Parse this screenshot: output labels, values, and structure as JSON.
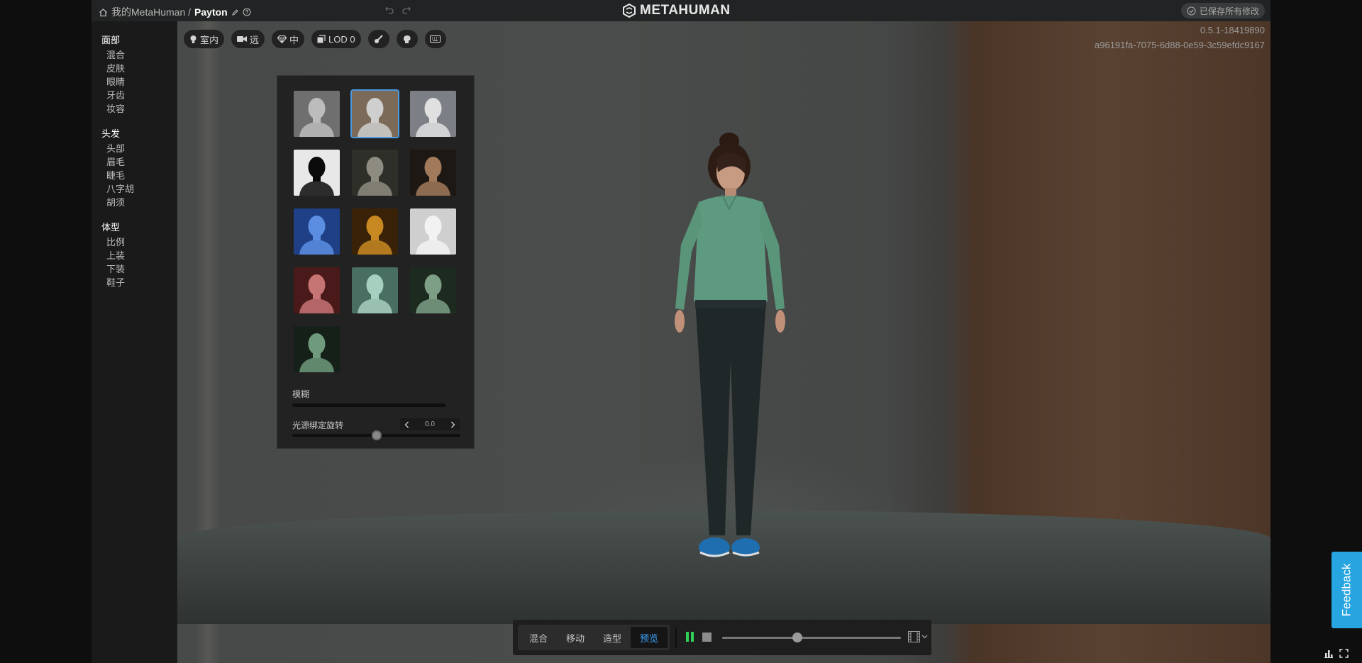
{
  "topbar": {
    "breadcrumb_root": "我的MetaHuman /",
    "breadcrumb_current": "Payton",
    "logo_text": "METAHUMAN",
    "saved_status": "已保存所有修改"
  },
  "version": {
    "build": "0.5.1-18419890",
    "id": "a96191fa-7075-6d88-0e59-3c59efdc9167"
  },
  "sidebar": {
    "sections": [
      {
        "title": "面部",
        "items": [
          "混合",
          "皮肤",
          "眼睛",
          "牙齿",
          "妆容"
        ]
      },
      {
        "title": "头发",
        "items": [
          "头部",
          "眉毛",
          "睫毛",
          "八字胡",
          "胡须"
        ]
      },
      {
        "title": "体型",
        "items": [
          "比例",
          "上装",
          "下装",
          "鞋子"
        ]
      }
    ]
  },
  "toolbar": {
    "lighting_label": "室内",
    "camera_label": "远",
    "quality_label": "中",
    "lod_label": "LOD 0"
  },
  "lighting_panel": {
    "selected_index": 1,
    "presets": [
      {
        "name": "studio",
        "bg": "#6f6f6f",
        "face": "#bcbcbc"
      },
      {
        "name": "studio-warm",
        "bg": "#7b6a58",
        "face": "#cfcfcf"
      },
      {
        "name": "studio-cool",
        "bg": "#7c7f86",
        "face": "#e0e0e0"
      },
      {
        "name": "silhouette",
        "bg": "#e8e8e8",
        "face": "#0a0a0a"
      },
      {
        "name": "dim",
        "bg": "#2f2f2a",
        "face": "#8e8c80"
      },
      {
        "name": "low-key",
        "bg": "#1d1814",
        "face": "#a07a5a"
      },
      {
        "name": "blue",
        "bg": "#1f3f86",
        "face": "#5b8ee0"
      },
      {
        "name": "amber",
        "bg": "#3a2208",
        "face": "#c88822"
      },
      {
        "name": "bright",
        "bg": "#cfcfcf",
        "face": "#f2f2f2"
      },
      {
        "name": "red",
        "bg": "#4a1a1a",
        "face": "#c77474"
      },
      {
        "name": "teal",
        "bg": "#496e62",
        "face": "#a7cfc0"
      },
      {
        "name": "green-night",
        "bg": "#1d2a20",
        "face": "#7d9f86"
      },
      {
        "name": "green-bokeh",
        "bg": "#142018",
        "face": "#6f9b7c"
      }
    ],
    "blur_label": "模糊",
    "blur_value": 0.0,
    "rotation_label": "光源绑定旋转",
    "rotation_value": "0.0"
  },
  "bottombar": {
    "modes": [
      "混合",
      "移动",
      "造型",
      "预览"
    ],
    "active_mode": "预览",
    "timeline_position": 0.42
  },
  "feedback_label": "Feedback"
}
